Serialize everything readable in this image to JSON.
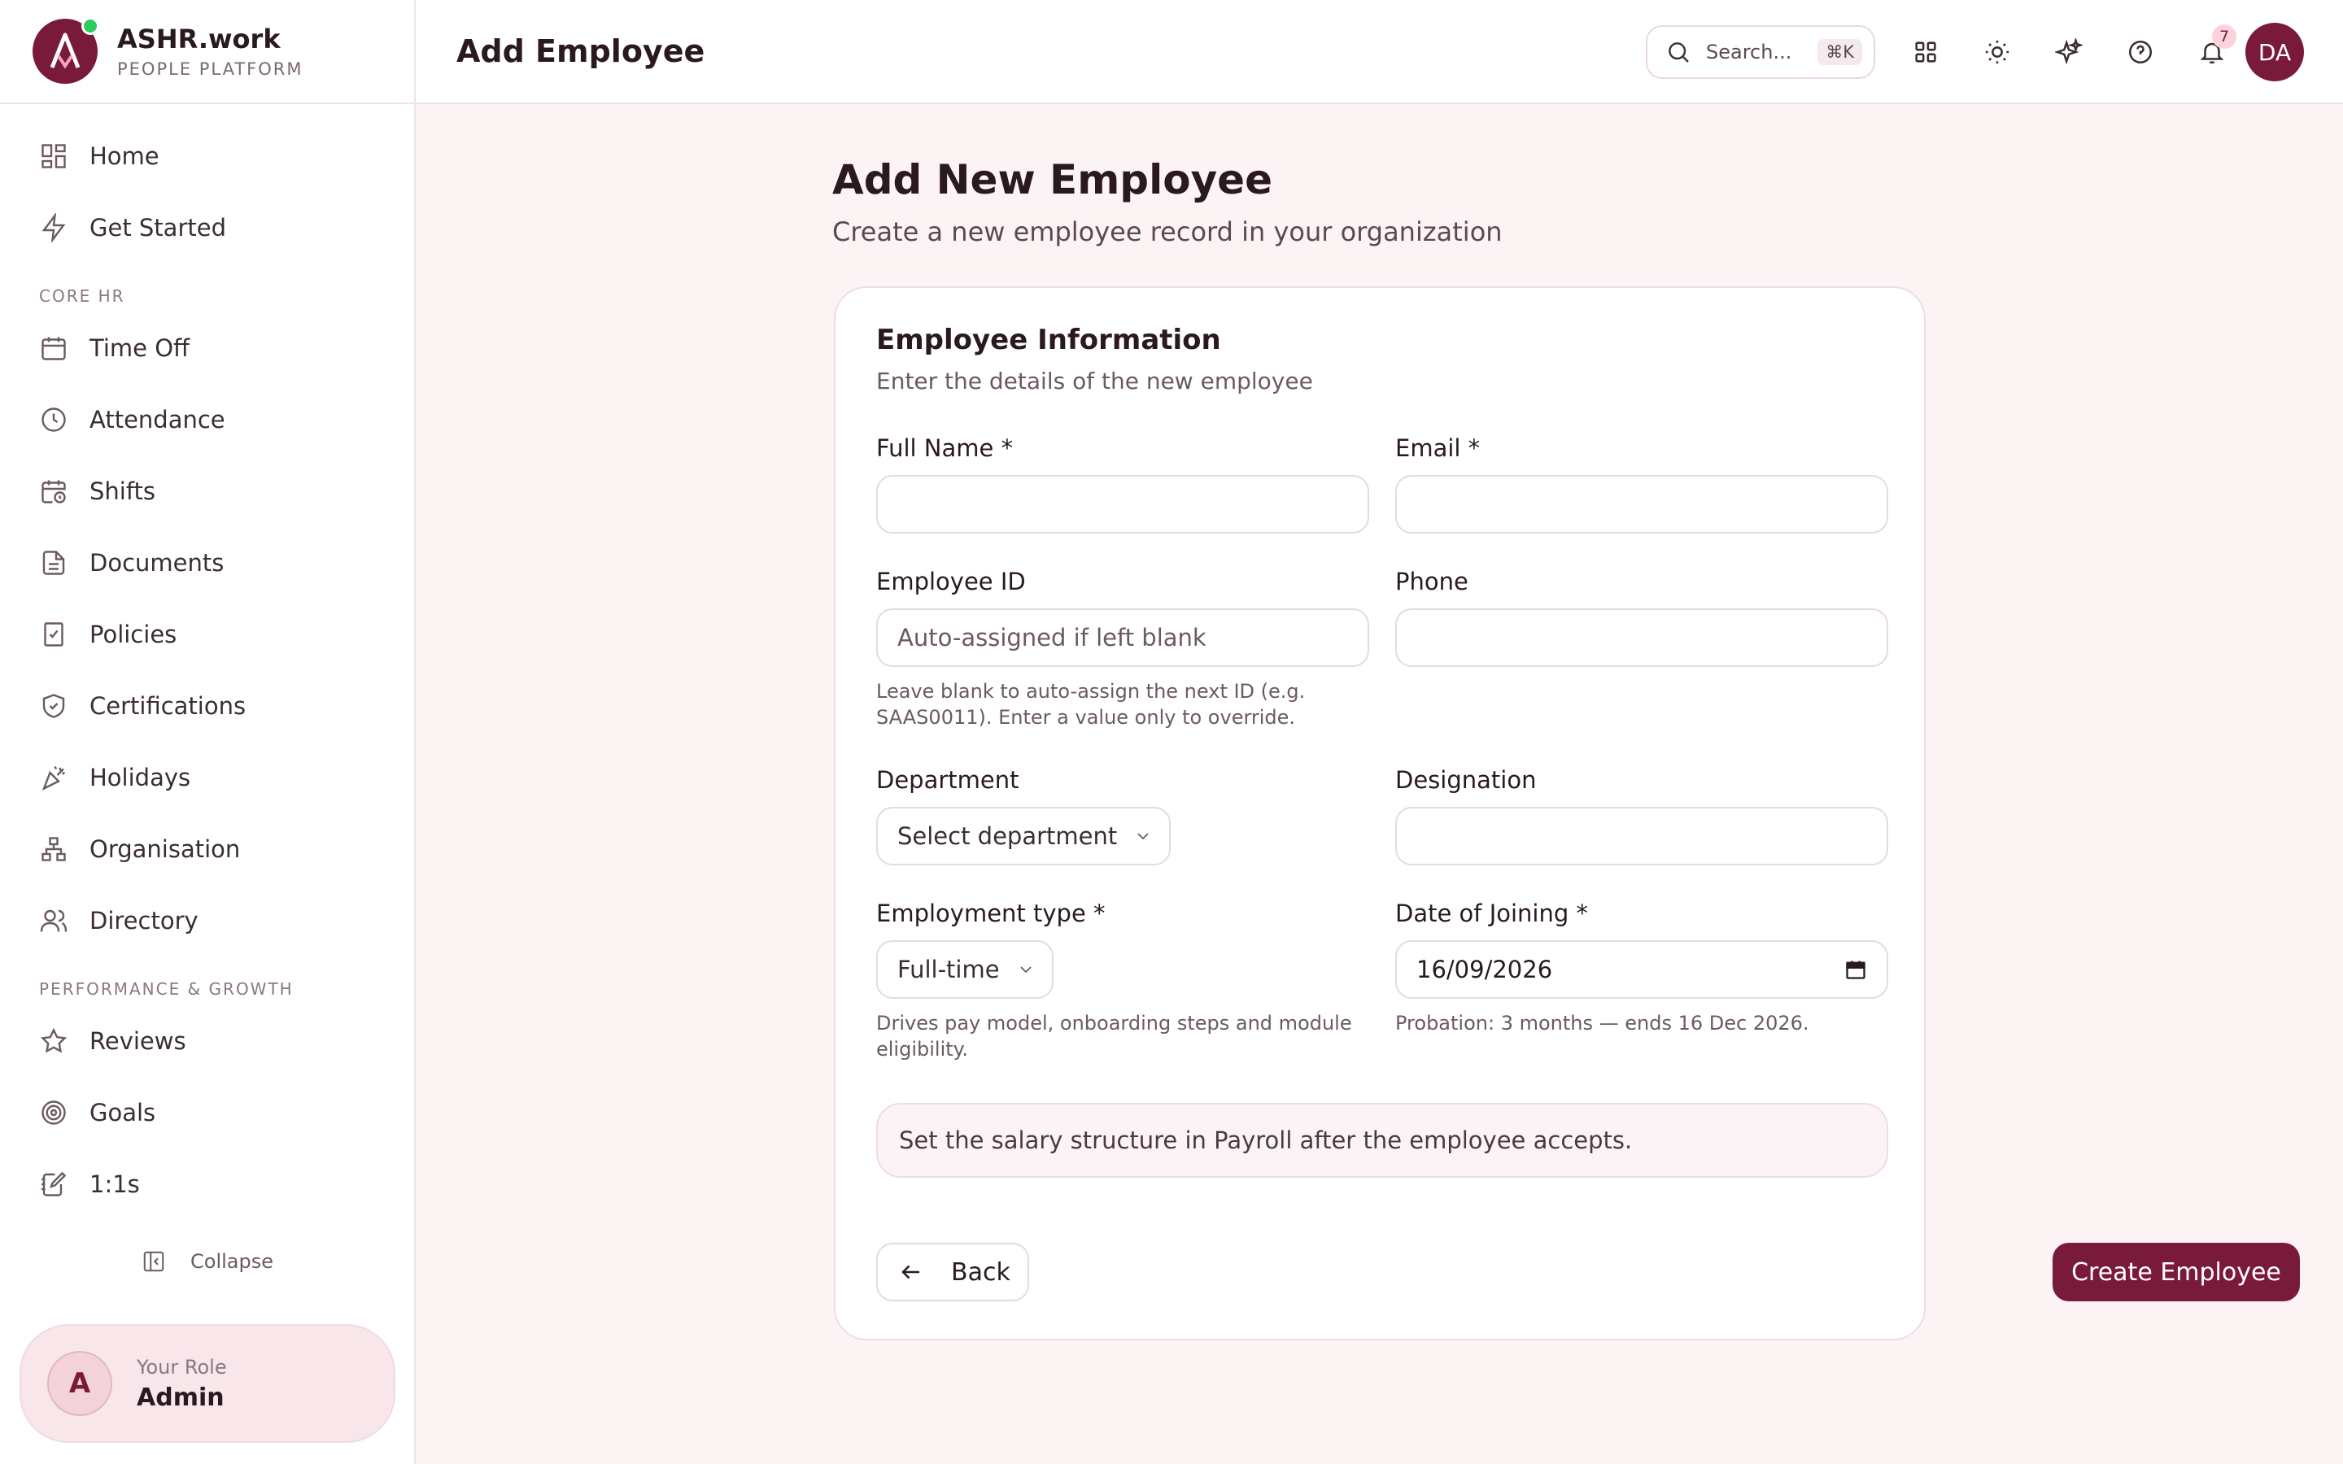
{
  "brand": {
    "name": "ASHR.work",
    "subtitle": "PEOPLE PLATFORM",
    "logo_letter": "A"
  },
  "sidebar": {
    "items_top": [
      {
        "label": "Home",
        "icon": "grid-icon"
      },
      {
        "label": "Get Started",
        "icon": "lightning-icon"
      }
    ],
    "section_core": "CORE HR",
    "items_core": [
      {
        "label": "Time Off",
        "icon": "calendar-icon"
      },
      {
        "label": "Attendance",
        "icon": "clock-icon"
      },
      {
        "label": "Shifts",
        "icon": "calendar-clock-icon"
      },
      {
        "label": "Documents",
        "icon": "document-icon"
      },
      {
        "label": "Policies",
        "icon": "policy-book-icon"
      },
      {
        "label": "Certifications",
        "icon": "shield-check-icon"
      },
      {
        "label": "Holidays",
        "icon": "party-popper-icon"
      },
      {
        "label": "Organisation",
        "icon": "org-chart-icon"
      },
      {
        "label": "Directory",
        "icon": "users-icon"
      }
    ],
    "section_perf": "PERFORMANCE & GROWTH",
    "items_perf": [
      {
        "label": "Reviews",
        "icon": "star-icon"
      },
      {
        "label": "Goals",
        "icon": "target-icon"
      },
      {
        "label": "1:1s",
        "icon": "notebook-icon"
      }
    ],
    "collapse_label": "Collapse",
    "role": {
      "avatar_letter": "A",
      "label": "Your Role",
      "value": "Admin"
    }
  },
  "topbar": {
    "title": "Add Employee",
    "search_placeholder": "Search...",
    "search_shortcut": "⌘K",
    "notifications_count": "7",
    "user_initials": "DA"
  },
  "page": {
    "title": "Add New Employee",
    "subtitle": "Create a new employee record in your organization"
  },
  "form": {
    "title": "Employee Information",
    "subtitle": "Enter the details of the new employee",
    "full_name_label": "Full Name *",
    "full_name_value": "",
    "email_label": "Email *",
    "email_value": "",
    "employee_id_label": "Employee ID",
    "employee_id_placeholder": "Auto-assigned if left blank",
    "employee_id_hint": "Leave blank to auto-assign the next ID (e.g. SAAS0011). Enter a value only to override.",
    "phone_label": "Phone",
    "phone_value": "",
    "department_label": "Department",
    "department_value": "Select department",
    "designation_label": "Designation",
    "designation_value": "",
    "employment_type_label": "Employment type *",
    "employment_type_value": "Full-time",
    "employment_type_hint": "Drives pay model, onboarding steps and module eligibility.",
    "doj_label": "Date of Joining *",
    "doj_value": "16/09/2026",
    "doj_hint": "Probation: 3 months — ends 16 Dec 2026.",
    "note": "Set the salary structure in Payroll after the employee accepts.",
    "back_label": "Back",
    "create_label": "Create Employee"
  },
  "colors": {
    "accent": "#7a1a3a",
    "background": "#fcf3f4",
    "online": "#2ecc5e"
  }
}
